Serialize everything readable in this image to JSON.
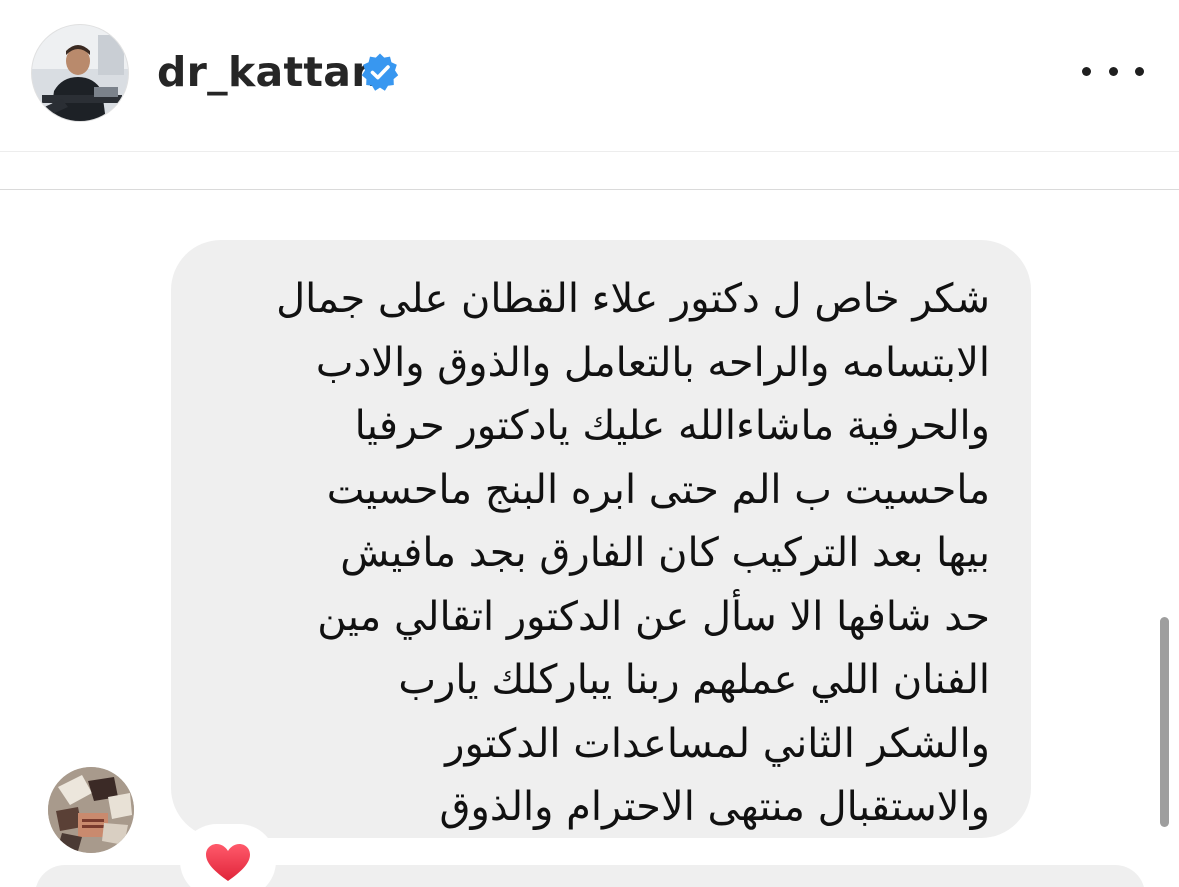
{
  "header": {
    "username": "dr_kattan",
    "verified_color": "#3897f0",
    "more_icon": "ellipsis-horizontal-icon"
  },
  "message": {
    "lines": [
      "شكر خاص ل دكتور علاء القطان على جمال",
      "الابتسامه والراحه بالتعامل والذوق والادب",
      "والحرفية ماشاءالله عليك يادكتور حرفيا",
      "ماحسيت ب الم حتى ابره البنج ماحسيت",
      "بيها بعد التركيب كان الفارق بجد مافيش",
      "حد شافها الا سأل عن الدكتور اتقالي مين",
      "الفنان اللي عملهم ربنا يباركلك يارب",
      "والشكر الثاني لمساعدات الدكتور",
      "والاستقبال منتهى الاحترام والذوق"
    ],
    "bubble_color": "#efefef",
    "reaction": "heart-icon"
  }
}
